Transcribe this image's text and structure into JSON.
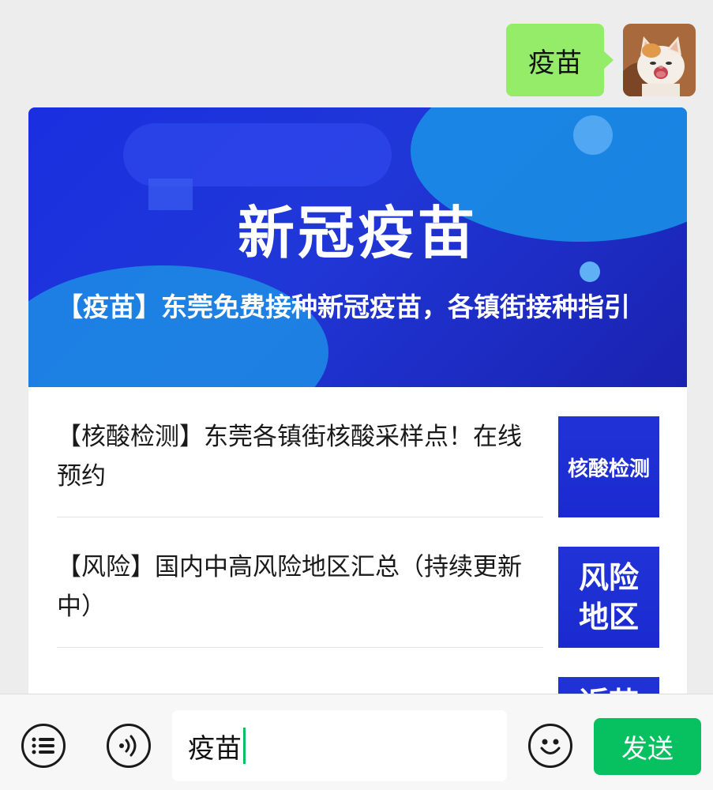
{
  "message": {
    "text": "疫苗",
    "bubble_color": "#95ec69"
  },
  "article": {
    "cover_title": "新冠疫苗",
    "cover_caption": "【疫苗】东莞免费接种新冠疫苗，各镇街接种指引",
    "items": [
      {
        "title": "【核酸检测】东莞各镇街核酸采样点！在线预约",
        "thumb_text": "核酸检测"
      },
      {
        "title": "【风险】国内中高风险地区汇总（持续更新中）",
        "thumb_text": "风险地区"
      },
      {
        "title": "",
        "thumb_text": "近苗"
      }
    ]
  },
  "inputbar": {
    "input_value": "疫苗",
    "send_label": "发送",
    "icons": [
      "menu-icon",
      "voice-icon",
      "emoji-icon"
    ],
    "accent_color": "#07c160"
  }
}
